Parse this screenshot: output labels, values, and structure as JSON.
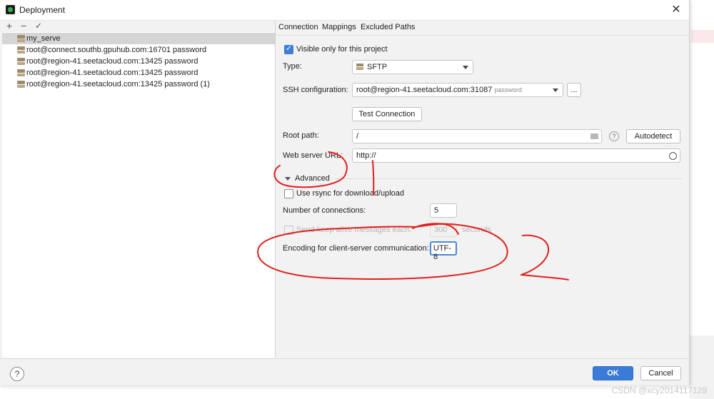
{
  "window": {
    "title": "Deployment",
    "close_icon": "close-icon"
  },
  "watermark": "CSDN @xcy2014117129",
  "left": {
    "toolbar": {
      "add": "+",
      "remove": "−",
      "check": "✓"
    },
    "servers": [
      {
        "label": "my_serve",
        "selected": true
      },
      {
        "label": "root@connect.southb.gpuhub.com:16701 password",
        "selected": false
      },
      {
        "label": "root@region-41.seetacloud.com:13425 password",
        "selected": false
      },
      {
        "label": "root@region-41.seetacloud.com:13425 password",
        "selected": false
      },
      {
        "label": "root@region-41.seetacloud.com:13425 password (1)",
        "selected": false
      }
    ]
  },
  "tabs": [
    {
      "label": "Connection",
      "active": true
    },
    {
      "label": "Mappings",
      "active": false
    },
    {
      "label": "Excluded Paths",
      "active": false
    }
  ],
  "connection": {
    "visible_only": {
      "label": "Visible only for this project",
      "checked": true
    },
    "type": {
      "label": "Type:",
      "value": "SFTP"
    },
    "ssh": {
      "label": "SSH configuration:",
      "value": "root@region-41.seetacloud.com:31087",
      "hint": "password",
      "more": "..."
    },
    "test_button": "Test Connection",
    "root_path": {
      "label": "Root path:",
      "value": "/",
      "help": "?",
      "autodetect": "Autodetect"
    },
    "web_url": {
      "label": "Web server URL:",
      "value": "http://"
    },
    "advanced": {
      "label": "Advanced",
      "expanded": true
    },
    "rsync": {
      "label": "Use rsync for download/upload",
      "checked": false
    },
    "num_connections": {
      "label": "Number of connections:",
      "value": "5"
    },
    "keep_alive": {
      "label": "Send keep alive messages each:",
      "value": "300",
      "unit": "seconds",
      "enabled": false
    },
    "encoding": {
      "label": "Encoding for client-server communication:",
      "value": "UTF-8"
    }
  },
  "footer": {
    "help": "?",
    "ok": "OK",
    "cancel": "Cancel"
  },
  "annotation": {
    "color": "#e0201a",
    "mark_text": "2"
  }
}
